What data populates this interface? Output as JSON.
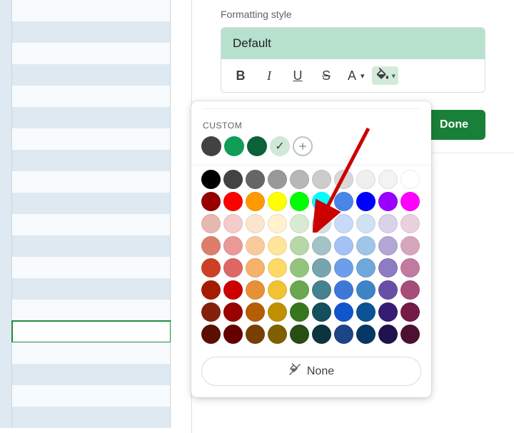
{
  "section_label": "Formatting style",
  "preview_text": "Default",
  "toolbar": {
    "bold": "B",
    "italic": "I",
    "underline": "U",
    "strike": "S",
    "font_color": "A"
  },
  "done_label": "Done",
  "custom_label": "CUSTOM",
  "custom_swatches": [
    "#424242",
    "#0f9d58",
    "#0b6138",
    "#cfe8d8"
  ],
  "none_label": "None",
  "spreadsheet": {
    "total_rows": 20,
    "active_row_index": 15
  },
  "palette": [
    [
      "#000000",
      "#434343",
      "#666666",
      "#999999",
      "#b7b7b7",
      "#cccccc",
      "#d9d9d9",
      "#efefef",
      "#f3f3f3",
      "#ffffff"
    ],
    [
      "#980000",
      "#ff0000",
      "#ff9900",
      "#ffff00",
      "#00ff00",
      "#00ffff",
      "#4a86e8",
      "#0000ff",
      "#9900ff",
      "#ff00ff"
    ],
    [
      "#e6b8af",
      "#f4cccc",
      "#fce5cd",
      "#fff2cc",
      "#d9ead3",
      "#d0e0e3",
      "#c9daf8",
      "#cfe2f3",
      "#d9d2e9",
      "#ead1dc"
    ],
    [
      "#dd7e6b",
      "#ea9999",
      "#f9cb9c",
      "#ffe599",
      "#b6d7a8",
      "#a2c4c9",
      "#a4c2f4",
      "#9fc5e8",
      "#b4a7d6",
      "#d5a6bd"
    ],
    [
      "#cc4125",
      "#e06666",
      "#f6b26b",
      "#ffd966",
      "#93c47d",
      "#76a5af",
      "#6d9eeb",
      "#6fa8dc",
      "#8e7cc3",
      "#c27ba0"
    ],
    [
      "#a61c00",
      "#cc0000",
      "#e69138",
      "#f1c232",
      "#6aa84f",
      "#45818e",
      "#3c78d8",
      "#3d85c6",
      "#674ea7",
      "#a64d79"
    ],
    [
      "#85200c",
      "#990000",
      "#b45f06",
      "#bf9000",
      "#38761d",
      "#134f5c",
      "#1155cc",
      "#0b5394",
      "#351c75",
      "#741b47"
    ],
    [
      "#5b0f00",
      "#660000",
      "#783f04",
      "#7f6000",
      "#274e13",
      "#0c343d",
      "#1c4587",
      "#073763",
      "#20124d",
      "#4c1130"
    ]
  ]
}
